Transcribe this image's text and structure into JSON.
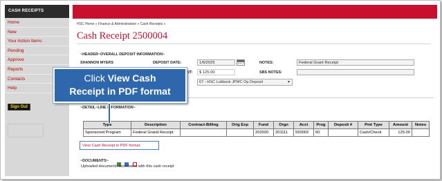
{
  "sidebar": {
    "header": "CASH RECEIPTS",
    "items": [
      {
        "label": "Home"
      },
      {
        "label": "New"
      },
      {
        "label": "Your Action Items"
      },
      {
        "label": "Pending"
      },
      {
        "label": "Approve"
      },
      {
        "label": "Reports"
      },
      {
        "label": "Contacts"
      },
      {
        "label": "Help"
      }
    ],
    "signout_label": "Sign Out"
  },
  "breadcrumb": "HSC Home  »  Finance & Administration  »  Cash Receipts  »",
  "page_title": "Cash Receipt 2500004",
  "header_section": {
    "title": "~HEADER~OVERALL DEPOSIT INFORMATION~",
    "preparer_name": "SHANNON MYERS",
    "deposit_date_label": "DEPOSIT DATE:",
    "deposit_date_value": "1/6/2025",
    "amount_label_tail": "NT:",
    "amount_value": "$ 125.00",
    "bank_select": "67 - HSC Lubbock JPMC Op Deposit",
    "notes_label": "NOTES:",
    "notes_value": "Federal Grant Receipt",
    "sbs_notes_label": "SBS NOTES:",
    "sbs_notes_value": ""
  },
  "detail_section": {
    "title": "~DETAIL~LINE INFORMATION~",
    "columns": [
      "Type",
      "Description",
      "Contract-Billing",
      "Orig Exp",
      "Fund",
      "Orgn",
      "Acct",
      "Prog",
      "Deposit #",
      "Pmt Type",
      "Amount",
      "Notes"
    ],
    "rows": [
      [
        "Sponsored Program",
        "Federal Grand Receipt",
        "",
        "",
        "202020",
        "201111",
        "550002",
        "60",
        "",
        "Cash/Check",
        "125.00",
        ""
      ]
    ]
  },
  "pdf_link_text": "View Cash Receipt in PDF format.",
  "documents_section": {
    "title": "~DOCUMENTS~",
    "note": "Uploaded documents associated with this cash receipt"
  },
  "callout": {
    "line1_prefix": "Click ",
    "line1_bold": "View Cash",
    "line2": "Receipt in PDF format"
  },
  "colors": {
    "brand_red": "#c8102e",
    "callout_blue": "#2f67ad",
    "sidebar_dark": "#2b2b2b"
  }
}
